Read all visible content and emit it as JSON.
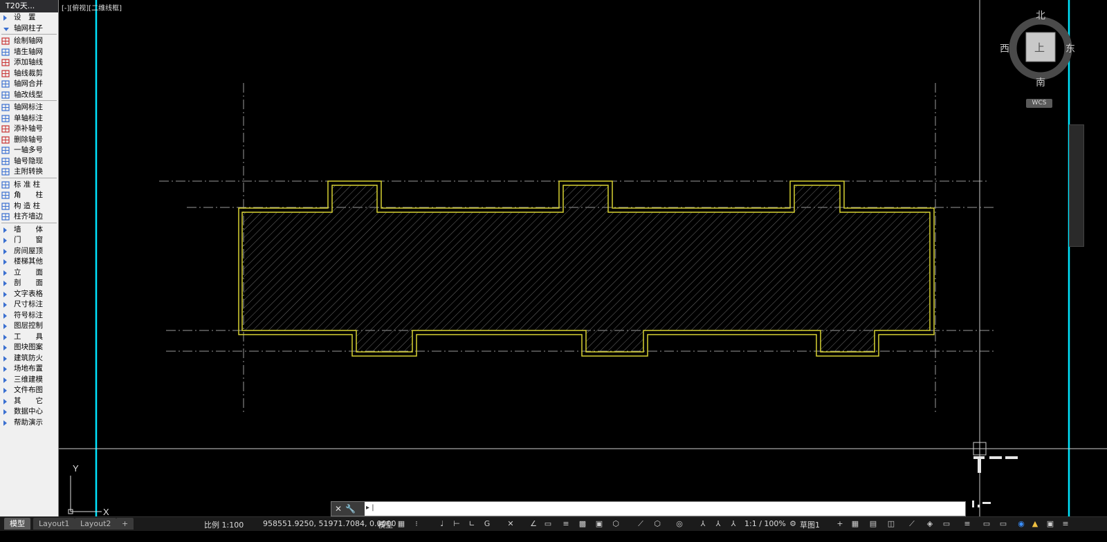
{
  "app": {
    "panel_title": "T20天..."
  },
  "viewport_label": "[-][俯视][二维线框]",
  "menu": [
    {
      "label": "设　置",
      "kind": "section"
    },
    {
      "label": "轴网柱子",
      "kind": "expanded"
    },
    {
      "label": "绘制轴网",
      "kind": "tool",
      "color": "#c83232"
    },
    {
      "label": "墙生轴网",
      "kind": "tool",
      "color": "#3a6fd0"
    },
    {
      "label": "添加轴线",
      "kind": "tool",
      "color": "#c83232"
    },
    {
      "label": "轴线裁剪",
      "kind": "tool",
      "color": "#c83232"
    },
    {
      "label": "轴网合并",
      "kind": "tool",
      "color": "#3a6fd0"
    },
    {
      "label": "轴改线型",
      "kind": "tool",
      "color": "#3a6fd0"
    },
    {
      "label": "轴网标注",
      "kind": "tool",
      "color": "#3a6fd0"
    },
    {
      "label": "单轴标注",
      "kind": "tool",
      "color": "#3a6fd0"
    },
    {
      "label": "添补轴号",
      "kind": "tool",
      "color": "#c83232"
    },
    {
      "label": "删除轴号",
      "kind": "tool",
      "color": "#c83232"
    },
    {
      "label": "一轴多号",
      "kind": "tool",
      "color": "#3a6fd0"
    },
    {
      "label": "轴号隐现",
      "kind": "tool",
      "color": "#3a6fd0"
    },
    {
      "label": "主附转换",
      "kind": "tool",
      "color": "#3a6fd0"
    },
    {
      "label": "标 准 柱",
      "kind": "tool",
      "color": "#3a6fd0"
    },
    {
      "label": "角　　柱",
      "kind": "tool",
      "color": "#3a6fd0"
    },
    {
      "label": "构 造 柱",
      "kind": "tool",
      "color": "#3a6fd0"
    },
    {
      "label": "柱齐墙边",
      "kind": "tool",
      "color": "#3a6fd0"
    },
    {
      "label": "墙　　体",
      "kind": "section"
    },
    {
      "label": "门　　窗",
      "kind": "section"
    },
    {
      "label": "房间屋顶",
      "kind": "section"
    },
    {
      "label": "楼梯其他",
      "kind": "section"
    },
    {
      "label": "立　　面",
      "kind": "section"
    },
    {
      "label": "剖　　面",
      "kind": "section"
    },
    {
      "label": "文字表格",
      "kind": "section"
    },
    {
      "label": "尺寸标注",
      "kind": "section"
    },
    {
      "label": "符号标注",
      "kind": "section"
    },
    {
      "label": "图层控制",
      "kind": "section"
    },
    {
      "label": "工　　具",
      "kind": "section"
    },
    {
      "label": "图块图案",
      "kind": "section"
    },
    {
      "label": "建筑防火",
      "kind": "section"
    },
    {
      "label": "场地布置",
      "kind": "section"
    },
    {
      "label": "三维建模",
      "kind": "section"
    },
    {
      "label": "文件布图",
      "kind": "section"
    },
    {
      "label": "其　　它",
      "kind": "section"
    },
    {
      "label": "数据中心",
      "kind": "section"
    },
    {
      "label": "帮助演示",
      "kind": "section"
    }
  ],
  "viewcube": {
    "north": "北",
    "south": "南",
    "east": "东",
    "west": "西",
    "face": "上",
    "wcs": "WCS"
  },
  "ucs": {
    "x": "X",
    "y": "Y"
  },
  "tabs": [
    {
      "label": "模型",
      "active": true
    },
    {
      "label": "Layout1",
      "active": false
    },
    {
      "label": "Layout2",
      "active": false
    },
    {
      "label": "+",
      "active": false
    }
  ],
  "status": {
    "scale": "比例 1:100",
    "coords": "958551.9250, 51971.7084, 0.0000",
    "space": "模型",
    "annoscale": "1:1 / 100%",
    "workspace": "草图1"
  },
  "colors": {
    "accent_cyan": "#00e5ff",
    "outline_yellow": "#d8d232",
    "hatch": "#6e6e6e",
    "axis": "#9a9a9a"
  }
}
